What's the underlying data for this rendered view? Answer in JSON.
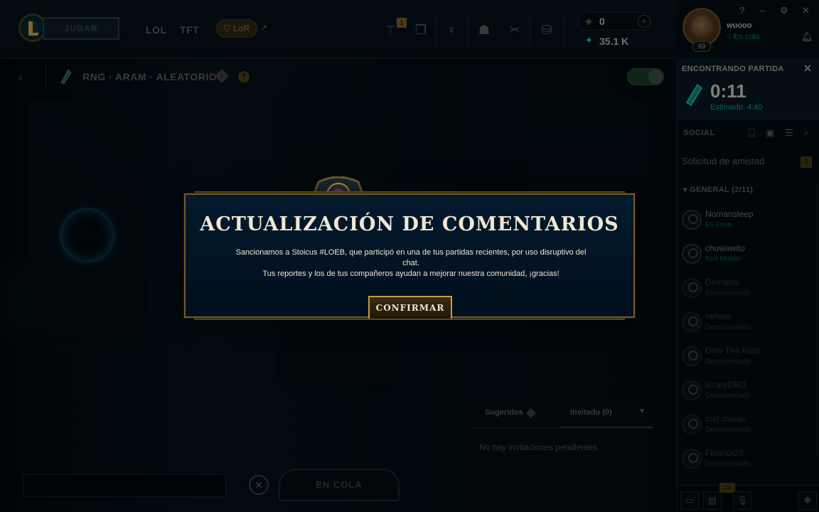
{
  "nav": {
    "play_label": "JUGAR",
    "links": [
      "LOL",
      "TFT"
    ],
    "lor_label": "LoR",
    "lor_arrow": "↗",
    "store_badge": "1",
    "icons": [
      "store-icon",
      "collection-icon",
      "ranked-icon",
      "loot-icon",
      "tft-pass-icon",
      "coins-icon"
    ]
  },
  "currency": {
    "rp": "0",
    "blue_essence": "35.1 K",
    "plus": "+"
  },
  "profile": {
    "name": "wuooo",
    "status": "En cola",
    "level": "69",
    "window_controls": [
      "?",
      "–",
      "⚙",
      "✕"
    ]
  },
  "lobby": {
    "mode_title": "RNG · ARAM · ALEATORIO",
    "info_icon": "i",
    "help_icon": "?",
    "back_icon": "‹",
    "invite_tabs": {
      "suggested": "Sugeridos",
      "invited": "Invitado (0)",
      "empty": "No hay invitaciones pendientes"
    },
    "queue_button": "EN COLA",
    "cancel_icon": "✕"
  },
  "finding": {
    "title": "ENCONTRANDO PARTIDA",
    "close": "✕",
    "timer": "0:11",
    "estimated": "Estimado: 4:40"
  },
  "social": {
    "header": "SOCIAL",
    "friend_request": "Solicitud de amistad",
    "friend_request_count": "2",
    "group": "▾  GENERAL (2/11)",
    "friends": [
      {
        "name": "Nomansleep",
        "status": "En línea",
        "kind": "online"
      },
      {
        "name": "chuwawito",
        "status": "Riot Mobile",
        "kind": "online"
      },
      {
        "name": "Demasia",
        "status": "Desconectado",
        "kind": "dim"
      },
      {
        "name": "nehate",
        "status": "Desconectado",
        "kind": "dim"
      },
      {
        "name": "Dino Tha hazo",
        "status": "Desconectado",
        "kind": "dim"
      },
      {
        "name": "iscaryDBO",
        "status": "Desconectado",
        "kind": "dim"
      },
      {
        "name": "mel chivas",
        "status": "Desconectado",
        "kind": "dim"
      },
      {
        "name": "Finanta23",
        "status": "Desconectado",
        "kind": "dim"
      }
    ],
    "footer_badge": "74"
  },
  "modal": {
    "title": "ACTUALIZACIÓN DE COMENTARIOS",
    "line1": "Sancionamos a Stoicus #LOEB, que participó en una de tus partidas recientes, por uso disruptivo del chat.",
    "line2": "Tus reportes y los de tus compañeros ayudan a mejorar nuestra comunidad, ¡gracias!",
    "confirm": "CONFIRMAR"
  }
}
